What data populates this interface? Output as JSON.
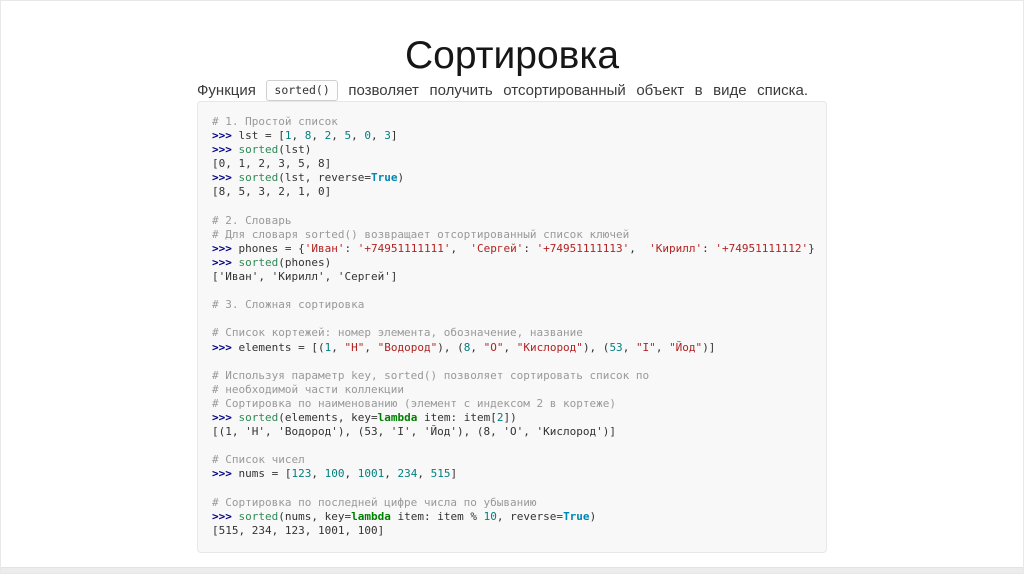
{
  "title": "Сортировка",
  "subtitle": {
    "prefix": "Функция",
    "code": "sorted()",
    "suffix": "позволяет получить отсортированный объект в виде списка."
  },
  "colors": {
    "comment": "#999999",
    "prompt": "#000080",
    "func": "#2e8b57",
    "keyword": "#008000",
    "number": "#008080",
    "bool": "#0086b3",
    "string": "#b22222",
    "plain": "#333333",
    "code_bg": "#f8f8f8",
    "code_border": "#e7e7e7"
  },
  "code": {
    "lines": [
      [
        [
          "cm",
          "# 1. Простой список"
        ]
      ],
      [
        [
          "p",
          ">>> "
        ],
        [
          "pl",
          "lst = ["
        ],
        [
          "n",
          "1"
        ],
        [
          "pl",
          ", "
        ],
        [
          "n",
          "8"
        ],
        [
          "pl",
          ", "
        ],
        [
          "n",
          "2"
        ],
        [
          "pl",
          ", "
        ],
        [
          "n",
          "5"
        ],
        [
          "pl",
          ", "
        ],
        [
          "n",
          "0"
        ],
        [
          "pl",
          ", "
        ],
        [
          "n",
          "3"
        ],
        [
          "pl",
          "]"
        ]
      ],
      [
        [
          "p",
          ">>> "
        ],
        [
          "fn",
          "sorted"
        ],
        [
          "pl",
          "(lst)"
        ]
      ],
      [
        [
          "pl",
          "[0, 1, 2, 3, 5, 8]"
        ]
      ],
      [
        [
          "p",
          ">>> "
        ],
        [
          "fn",
          "sorted"
        ],
        [
          "pl",
          "(lst, reverse="
        ],
        [
          "b",
          "True"
        ],
        [
          "pl",
          ")"
        ]
      ],
      [
        [
          "pl",
          "[8, 5, 3, 2, 1, 0]"
        ]
      ],
      [],
      [
        [
          "cm",
          "# 2. Словарь"
        ]
      ],
      [
        [
          "cm",
          "# Для словаря sorted() возвращает отсортированный список ключей"
        ]
      ],
      [
        [
          "p",
          ">>> "
        ],
        [
          "pl",
          "phones = {"
        ],
        [
          "s",
          "'Иван'"
        ],
        [
          "pl",
          ": "
        ],
        [
          "s",
          "'+74951111111'"
        ],
        [
          "pl",
          ",  "
        ],
        [
          "s",
          "'Сергей'"
        ],
        [
          "pl",
          ": "
        ],
        [
          "s",
          "'+74951111113'"
        ],
        [
          "pl",
          ",  "
        ],
        [
          "s",
          "'Кирилл'"
        ],
        [
          "pl",
          ": "
        ],
        [
          "s",
          "'+74951111112'"
        ],
        [
          "pl",
          "}"
        ]
      ],
      [
        [
          "p",
          ">>> "
        ],
        [
          "fn",
          "sorted"
        ],
        [
          "pl",
          "(phones)"
        ]
      ],
      [
        [
          "pl",
          "['Иван', 'Кирилл', 'Сергей']"
        ]
      ],
      [],
      [
        [
          "cm",
          "# 3. Сложная сортировка"
        ]
      ],
      [],
      [
        [
          "cm",
          "# Список кортежей: номер элемента, обозначение, название"
        ]
      ],
      [
        [
          "p",
          ">>> "
        ],
        [
          "pl",
          "elements = [("
        ],
        [
          "n",
          "1"
        ],
        [
          "pl",
          ", "
        ],
        [
          "s",
          "\"H\""
        ],
        [
          "pl",
          ", "
        ],
        [
          "s",
          "\"Водород\""
        ],
        [
          "pl",
          "), ("
        ],
        [
          "n",
          "8"
        ],
        [
          "pl",
          ", "
        ],
        [
          "s",
          "\"O\""
        ],
        [
          "pl",
          ", "
        ],
        [
          "s",
          "\"Кислород\""
        ],
        [
          "pl",
          "), ("
        ],
        [
          "n",
          "53"
        ],
        [
          "pl",
          ", "
        ],
        [
          "s",
          "\"I\""
        ],
        [
          "pl",
          ", "
        ],
        [
          "s",
          "\"Йод\""
        ],
        [
          "pl",
          ")]"
        ]
      ],
      [],
      [
        [
          "cm",
          "# Используя параметр key, sorted() позволяет сортировать список по"
        ]
      ],
      [
        [
          "cm",
          "# необходимой части коллекции"
        ]
      ],
      [
        [
          "cm",
          "# Сортировка по наименованию (элемент с индексом 2 в кортеже)"
        ]
      ],
      [
        [
          "p",
          ">>> "
        ],
        [
          "fn",
          "sorted"
        ],
        [
          "pl",
          "(elements, key="
        ],
        [
          "kw",
          "lambda"
        ],
        [
          "pl",
          " item: item["
        ],
        [
          "n",
          "2"
        ],
        [
          "pl",
          "])"
        ]
      ],
      [
        [
          "pl",
          "[(1, 'H', 'Водород'), (53, 'I', 'Йод'), (8, 'O', 'Кислород')]"
        ]
      ],
      [],
      [
        [
          "cm",
          "# Список чисел"
        ]
      ],
      [
        [
          "p",
          ">>> "
        ],
        [
          "pl",
          "nums = ["
        ],
        [
          "n",
          "123"
        ],
        [
          "pl",
          ", "
        ],
        [
          "n",
          "100"
        ],
        [
          "pl",
          ", "
        ],
        [
          "n",
          "1001"
        ],
        [
          "pl",
          ", "
        ],
        [
          "n",
          "234"
        ],
        [
          "pl",
          ", "
        ],
        [
          "n",
          "515"
        ],
        [
          "pl",
          "]"
        ]
      ],
      [],
      [
        [
          "cm",
          "# Сортировка по последней цифре числа по убыванию"
        ]
      ],
      [
        [
          "p",
          ">>> "
        ],
        [
          "fn",
          "sorted"
        ],
        [
          "pl",
          "(nums, key="
        ],
        [
          "kw",
          "lambda"
        ],
        [
          "pl",
          " item: item % "
        ],
        [
          "n",
          "10"
        ],
        [
          "pl",
          ", reverse="
        ],
        [
          "b",
          "True"
        ],
        [
          "pl",
          ")"
        ]
      ],
      [
        [
          "pl",
          "[515, 234, 123, 1001, 100]"
        ]
      ]
    ]
  }
}
